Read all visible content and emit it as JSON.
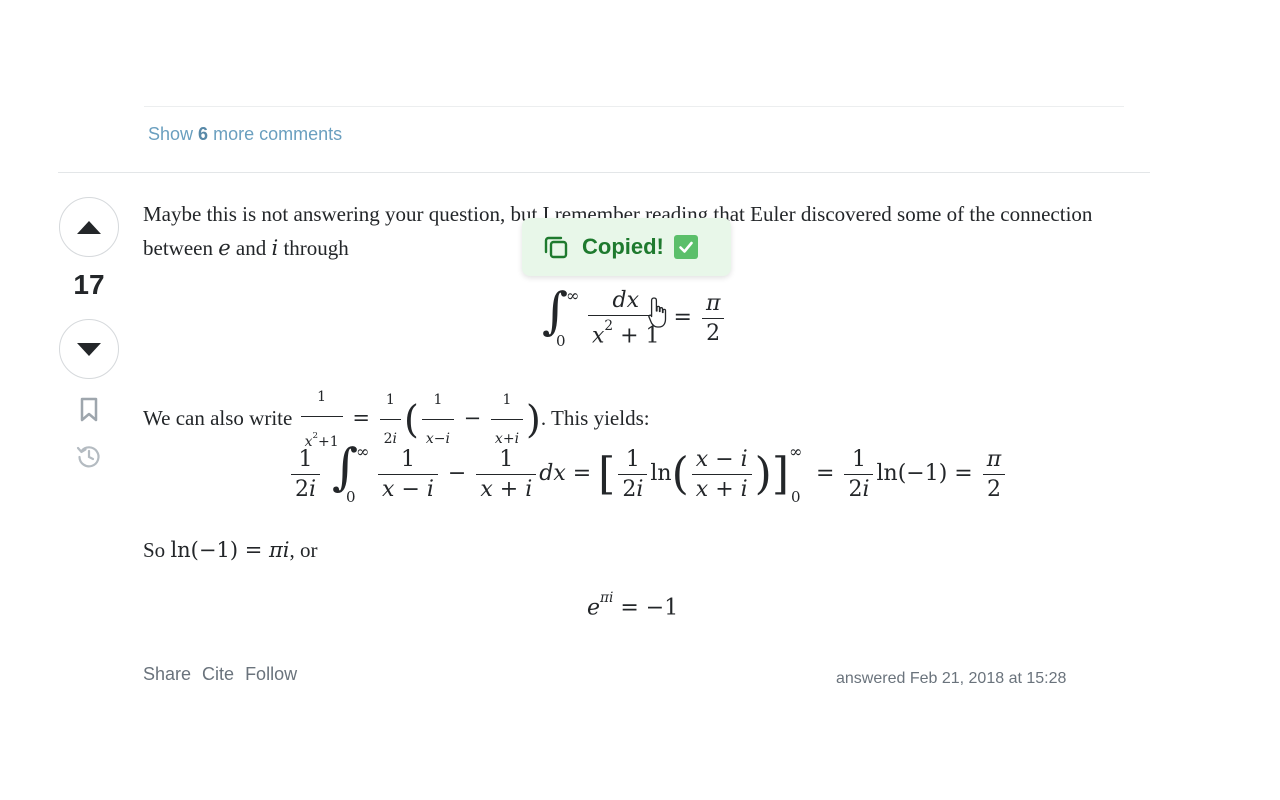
{
  "comments": {
    "show_prefix": "Show",
    "count": "6",
    "show_suffix": "more comments"
  },
  "vote": {
    "count": "17"
  },
  "body": {
    "p1_text": "Maybe this is not answering your question, but I remember reading that Euler discovered some of the connection between",
    "p1_and": "and",
    "p1_tail": "through",
    "p2_prefix": "We can also write",
    "p2_suffix": ". This yields:",
    "p3_prefix": "So",
    "p3_suffix": ", or"
  },
  "toast": {
    "text": "Copied!"
  },
  "footer": {
    "share": "Share",
    "cite": "Cite",
    "follow": "Follow",
    "answered": "answered Feb 21, 2018 at 15:28"
  },
  "colors": {
    "link": "#6a9fbf",
    "toast_bg": "#e8f7e9",
    "toast_text": "#1e7a2e",
    "check_bg": "#5bbf6a"
  },
  "icons": [
    "upvote-icon",
    "downvote-icon",
    "bookmark-icon",
    "history-icon",
    "copy-icon",
    "check-icon",
    "hand-cursor-icon"
  ]
}
